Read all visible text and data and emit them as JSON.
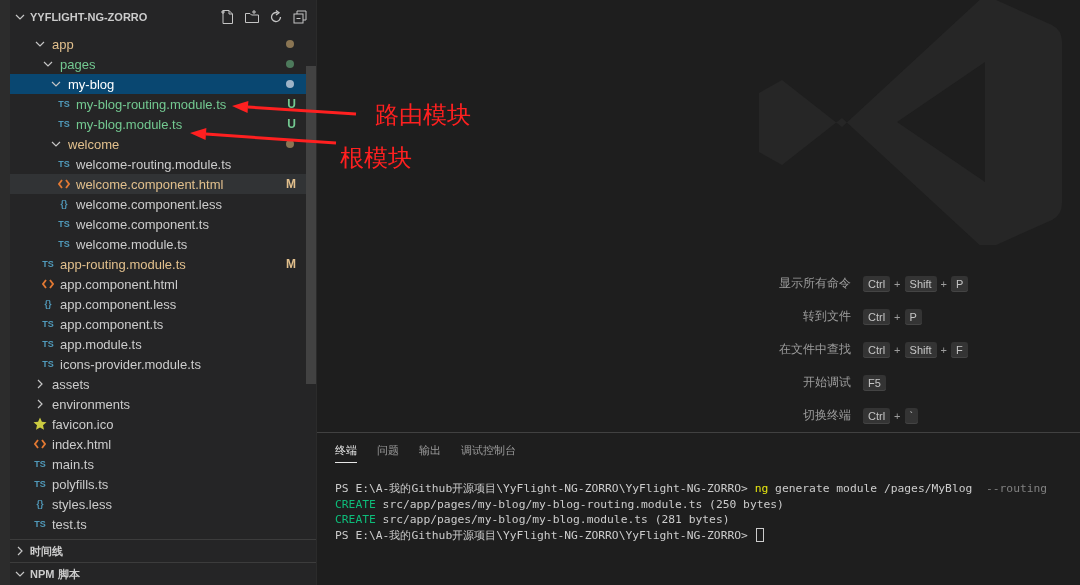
{
  "explorer": {
    "title": "YYFLIGHT-NG-ZORRO",
    "expanded": true,
    "tree": [
      {
        "name": "app",
        "kind": "folder",
        "expanded": true,
        "modified": true,
        "untracked": false,
        "selected": false,
        "hovered": false,
        "children": [
          {
            "name": "pages",
            "kind": "folder",
            "expanded": true,
            "modified": false,
            "untracked": true,
            "selected": false,
            "hovered": false,
            "children": [
              {
                "name": "my-blog",
                "kind": "folder",
                "expanded": true,
                "modified": false,
                "untracked": true,
                "selected": true,
                "hovered": false,
                "children": [
                  {
                    "name": "my-blog-routing.module.ts",
                    "kind": "ts",
                    "icon": "TS",
                    "modified": false,
                    "untracked": true,
                    "badge": "U",
                    "selected": false,
                    "hovered": false
                  },
                  {
                    "name": "my-blog.module.ts",
                    "kind": "ts",
                    "icon": "TS",
                    "modified": false,
                    "untracked": true,
                    "badge": "U",
                    "selected": false,
                    "hovered": false
                  }
                ]
              },
              {
                "name": "welcome",
                "kind": "folder",
                "expanded": true,
                "modified": true,
                "untracked": false,
                "selected": false,
                "hovered": false,
                "children": [
                  {
                    "name": "welcome-routing.module.ts",
                    "kind": "ts",
                    "icon": "TS",
                    "modified": false,
                    "untracked": false,
                    "selected": false,
                    "hovered": false
                  },
                  {
                    "name": "welcome.component.html",
                    "kind": "html",
                    "modified": true,
                    "untracked": false,
                    "badge": "M",
                    "selected": false,
                    "hovered": true
                  },
                  {
                    "name": "welcome.component.less",
                    "kind": "less",
                    "icon": "{}",
                    "modified": false,
                    "untracked": false,
                    "selected": false,
                    "hovered": false
                  },
                  {
                    "name": "welcome.component.ts",
                    "kind": "ts",
                    "icon": "TS",
                    "modified": false,
                    "untracked": false,
                    "selected": false,
                    "hovered": false
                  },
                  {
                    "name": "welcome.module.ts",
                    "kind": "ts",
                    "icon": "TS",
                    "modified": false,
                    "untracked": false,
                    "selected": false,
                    "hovered": false
                  }
                ]
              }
            ]
          },
          {
            "name": "app-routing.module.ts",
            "kind": "ts",
            "icon": "TS",
            "modified": true,
            "untracked": false,
            "badge": "M",
            "selected": false,
            "hovered": false
          },
          {
            "name": "app.component.html",
            "kind": "html",
            "modified": false,
            "untracked": false,
            "selected": false,
            "hovered": false
          },
          {
            "name": "app.component.less",
            "kind": "less",
            "icon": "{}",
            "modified": false,
            "untracked": false,
            "selected": false,
            "hovered": false
          },
          {
            "name": "app.component.ts",
            "kind": "ts",
            "icon": "TS",
            "modified": false,
            "untracked": false,
            "selected": false,
            "hovered": false
          },
          {
            "name": "app.module.ts",
            "kind": "ts",
            "icon": "TS",
            "modified": false,
            "untracked": false,
            "selected": false,
            "hovered": false
          },
          {
            "name": "icons-provider.module.ts",
            "kind": "ts",
            "icon": "TS",
            "modified": false,
            "untracked": false,
            "selected": false,
            "hovered": false
          }
        ]
      },
      {
        "name": "assets",
        "kind": "folder",
        "expanded": false,
        "modified": false,
        "untracked": false,
        "selected": false,
        "hovered": false
      },
      {
        "name": "environments",
        "kind": "folder",
        "expanded": false,
        "modified": false,
        "untracked": false,
        "selected": false,
        "hovered": false
      },
      {
        "name": "favicon.ico",
        "kind": "ico",
        "modified": false,
        "untracked": false,
        "selected": false,
        "hovered": false
      },
      {
        "name": "index.html",
        "kind": "html",
        "modified": false,
        "untracked": false,
        "selected": false,
        "hovered": false
      },
      {
        "name": "main.ts",
        "kind": "ts",
        "icon": "TS",
        "modified": false,
        "untracked": false,
        "selected": false,
        "hovered": false
      },
      {
        "name": "polyfills.ts",
        "kind": "ts",
        "icon": "TS",
        "modified": false,
        "untracked": false,
        "selected": false,
        "hovered": false
      },
      {
        "name": "styles.less",
        "kind": "less",
        "icon": "{}",
        "modified": false,
        "untracked": false,
        "selected": false,
        "hovered": false
      },
      {
        "name": "test.ts",
        "kind": "ts",
        "icon": "TS",
        "modified": false,
        "untracked": false,
        "selected": false,
        "hovered": false
      }
    ]
  },
  "sections": [
    {
      "title": "时间线",
      "expanded": false
    },
    {
      "title": "NPM 脚本",
      "expanded": true
    }
  ],
  "shortcuts": [
    {
      "label": "显示所有命令",
      "keys": [
        "Ctrl",
        "+",
        "Shift",
        "+",
        "P"
      ]
    },
    {
      "label": "转到文件",
      "keys": [
        "Ctrl",
        "+",
        "P"
      ]
    },
    {
      "label": "在文件中查找",
      "keys": [
        "Ctrl",
        "+",
        "Shift",
        "+",
        "F"
      ]
    },
    {
      "label": "开始调试",
      "keys": [
        "F5"
      ]
    },
    {
      "label": "切换终端",
      "keys": [
        "Ctrl",
        "+",
        "`"
      ]
    }
  ],
  "panel": {
    "tabs": [
      {
        "label": "终端",
        "selected": true
      },
      {
        "label": "问题",
        "selected": false
      },
      {
        "label": "输出",
        "selected": false
      },
      {
        "label": "调试控制台",
        "selected": false
      }
    ],
    "terminal": [
      {
        "cursor": false,
        "segments": [
          {
            "text": "PS E:\\A-我的Github开源项目\\YyFlight-NG-ZORRO\\YyFlight-NG-ZORRO> ",
            "color": "#cccccc"
          },
          {
            "text": "ng",
            "color": "#e5e510"
          },
          {
            "text": " generate module /pages/MyBlog",
            "color": "#cccccc"
          },
          {
            "text": "  --routing",
            "color": "#808080"
          }
        ]
      },
      {
        "cursor": false,
        "segments": [
          {
            "text": "CREATE",
            "color": "#0dbc79"
          },
          {
            "text": " src/app/pages/my-blog/my-blog-routing.module.ts (250 bytes)",
            "color": "#cccccc"
          }
        ]
      },
      {
        "cursor": false,
        "segments": [
          {
            "text": "CREATE",
            "color": "#0dbc79"
          },
          {
            "text": " src/app/pages/my-blog/my-blog.module.ts (281 bytes)",
            "color": "#cccccc"
          }
        ]
      },
      {
        "cursor": true,
        "segments": [
          {
            "text": "PS E:\\A-我的Github开源项目\\YyFlight-NG-ZORRO\\YyFlight-NG-ZORRO> ",
            "color": "#cccccc"
          }
        ]
      }
    ]
  },
  "annotations": [
    {
      "label": "路由模块"
    },
    {
      "label": "根模块"
    }
  ]
}
